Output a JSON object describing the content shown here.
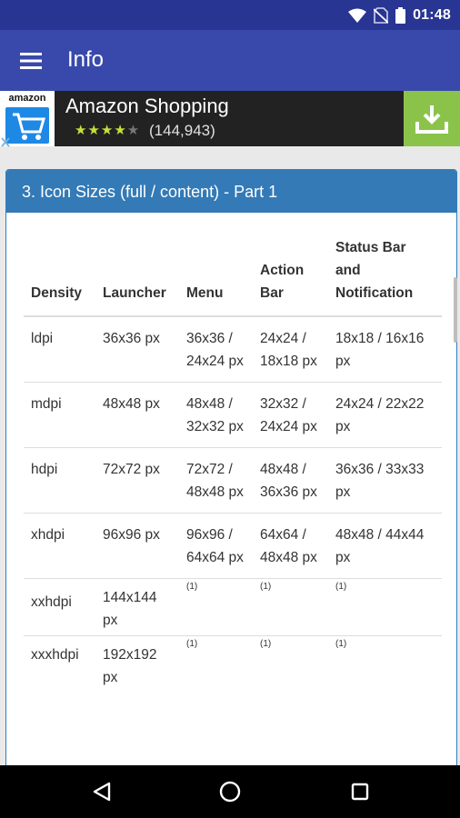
{
  "status_bar": {
    "time": "01:48",
    "icons": [
      "wifi-icon",
      "no-sim-icon",
      "battery-icon"
    ]
  },
  "app_bar": {
    "title": "Info",
    "menu_icon": "hamburger-menu-icon"
  },
  "ad": {
    "logo_text": "amazon",
    "title": "Amazon Shopping",
    "rating_stars": 4,
    "rating_count": "(144,943)",
    "install_icon": "download-icon"
  },
  "card": {
    "title": "3. Icon Sizes (full / content) - Part 1",
    "columns": [
      "Density",
      "Launcher",
      "Menu",
      "Action Bar",
      "Status Bar and Notification"
    ],
    "rows": [
      {
        "density": "ldpi",
        "launcher": "36x36 px",
        "menu": "36x36 / 24x24 px",
        "action_bar": "24x24 / 18x18 px",
        "status": "18x18 / 16x16 px"
      },
      {
        "density": "mdpi",
        "launcher": "48x48 px",
        "menu": "48x48 / 32x32 px",
        "action_bar": "32x32 / 24x24 px",
        "status": "24x24 / 22x22 px"
      },
      {
        "density": "hdpi",
        "launcher": "72x72 px",
        "menu": "72x72 / 48x48 px",
        "action_bar": "48x48 / 36x36 px",
        "status": "36x36 / 33x33 px"
      },
      {
        "density": "xhdpi",
        "launcher": "96x96 px",
        "menu": "96x96 / 64x64 px",
        "action_bar": "64x64 / 48x48 px",
        "status": "48x48 / 44x44 px"
      },
      {
        "density": "xxhdpi",
        "launcher": "144x144 px",
        "menu": "(1)",
        "action_bar": "(1)",
        "status": "(1)"
      },
      {
        "density": "xxxhdpi",
        "launcher": "192x192 px",
        "menu": "(1)",
        "action_bar": "(1)",
        "status": "(1)"
      }
    ]
  },
  "nav_bar": {
    "back_icon": "back-triangle-icon",
    "home_icon": "home-circle-icon",
    "recents_icon": "recents-square-icon"
  },
  "colors": {
    "status_bar": "#283593",
    "app_bar": "#3949ab",
    "card_header": "#337ab7",
    "install_button": "#8bc34a"
  }
}
